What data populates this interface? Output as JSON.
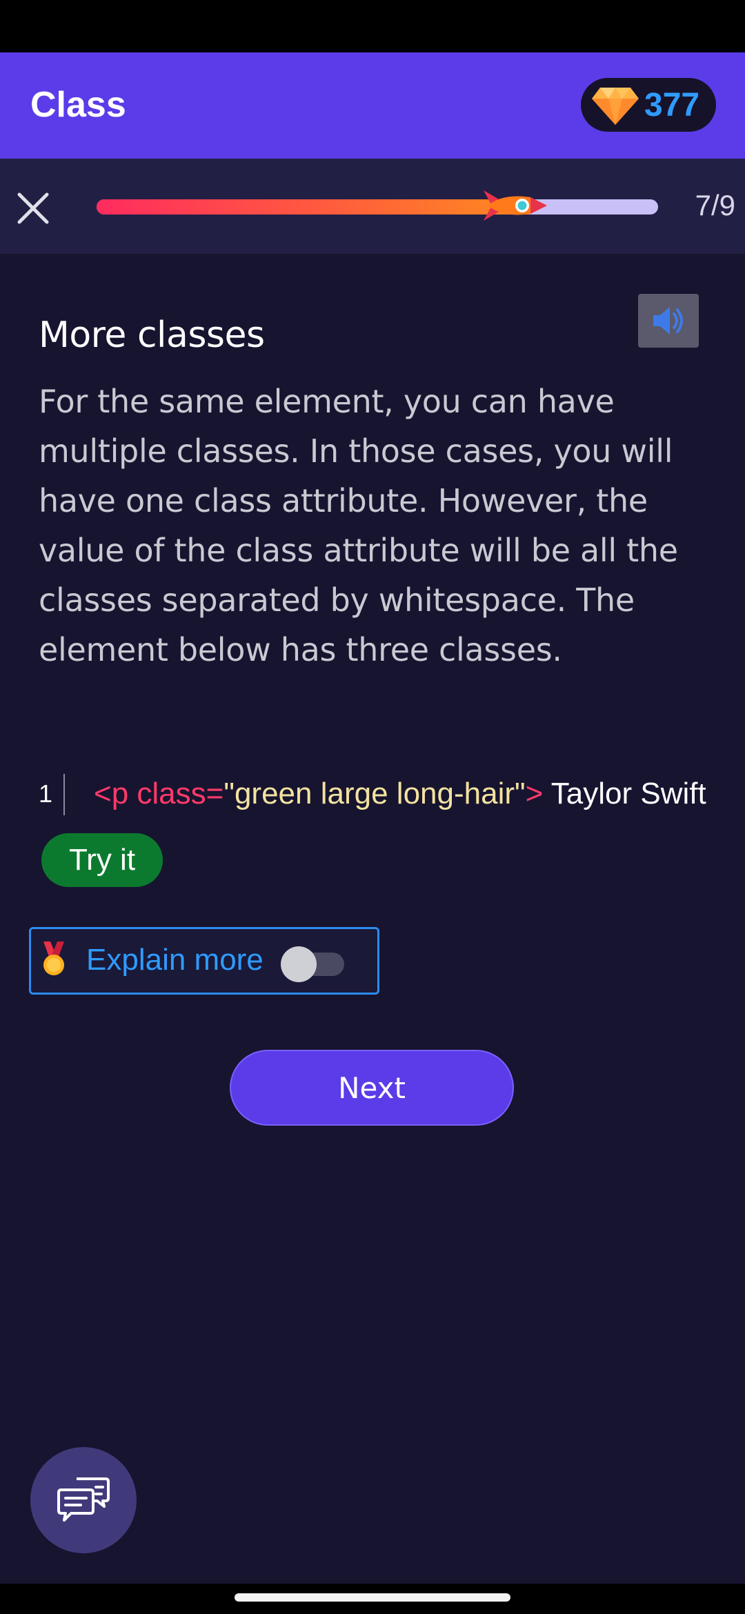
{
  "header": {
    "title": "Class",
    "gems": "377",
    "gem_icon": "diamond-icon"
  },
  "progress": {
    "current_step": 7,
    "total_steps": 9,
    "label": "7/9",
    "fill_fraction": 0.78,
    "marker_icon": "rocket-icon",
    "close_icon": "close-icon"
  },
  "lesson": {
    "title": "More classes",
    "audio_icon": "speaker-icon",
    "body": "For the same element, you can have multiple classes. In those cases, you will have one class attribute. However, the value of the class attribute will be all the classes separated by whitespace. The element below has three classes."
  },
  "code": {
    "line_number": "1",
    "tag_open": "<p class=",
    "attr_value": "\"green large long-hair\"",
    "tag_close": ">",
    "content": " Taylor Swift"
  },
  "actions": {
    "try_label": "Try it",
    "explain_label": "Explain more",
    "explain_icon": "medal-icon",
    "explain_toggle_on": false,
    "next_label": "Next",
    "chat_icon": "chat-bubbles-icon"
  },
  "colors": {
    "accent": "#5b3ce8",
    "background": "#171430",
    "try_button": "#0c7a2e",
    "link_blue": "#2f9bff",
    "code_tag": "#ff3a6a",
    "code_value": "#f3e3a0"
  }
}
